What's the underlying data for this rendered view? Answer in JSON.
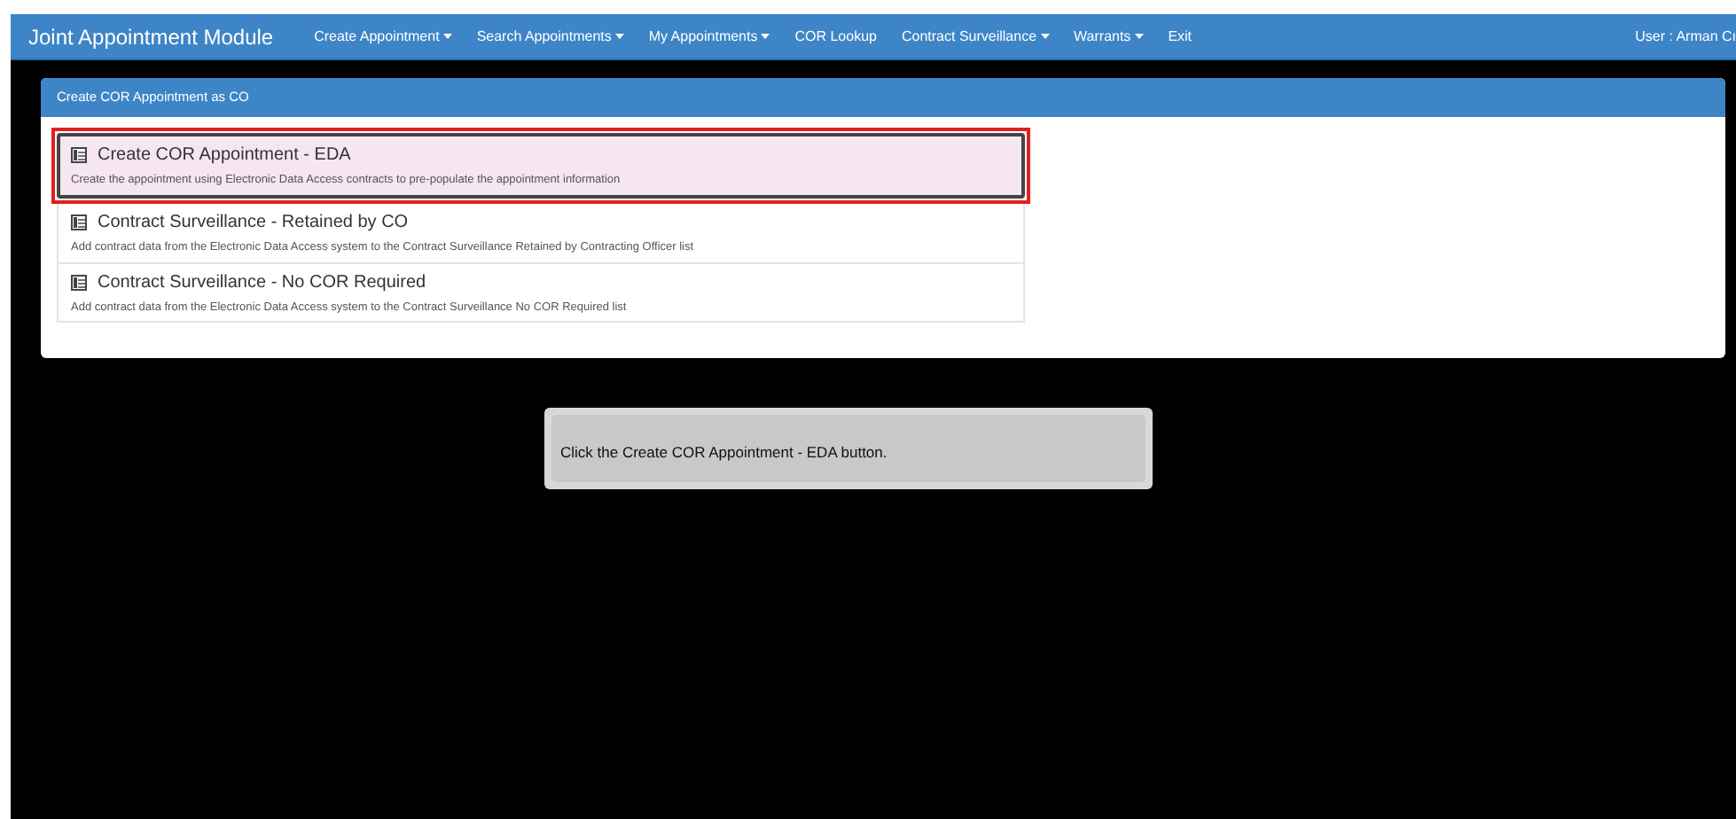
{
  "navbar": {
    "brand": "Joint Appointment Module",
    "menus": [
      {
        "label": "Create Appointment",
        "dropdown": true
      },
      {
        "label": "Search Appointments",
        "dropdown": true
      },
      {
        "label": "My Appointments",
        "dropdown": true
      },
      {
        "label": "COR Lookup",
        "dropdown": false
      },
      {
        "label": "Contract Surveillance",
        "dropdown": true
      },
      {
        "label": "Warrants",
        "dropdown": true
      },
      {
        "label": "Exit",
        "dropdown": false
      }
    ],
    "user": "User : Arman Cı"
  },
  "panel": {
    "title": "Create COR Appointment as CO",
    "items": [
      {
        "title": "Create COR Appointment - EDA",
        "description": "Create the appointment using Electronic Data Access contracts to pre-populate the appointment information",
        "selected": true
      },
      {
        "title": "Contract Surveillance - Retained by CO",
        "description": "Add contract data from the Electronic Data Access system to the Contract Surveillance Retained by Contracting Officer list",
        "selected": false
      },
      {
        "title": "Contract Surveillance - No COR Required",
        "description": "Add contract data from the Electronic Data Access system to the Contract Surveillance No COR Required list",
        "selected": false
      }
    ]
  },
  "tooltip": {
    "text": "Click the Create COR Appointment - EDA button."
  }
}
